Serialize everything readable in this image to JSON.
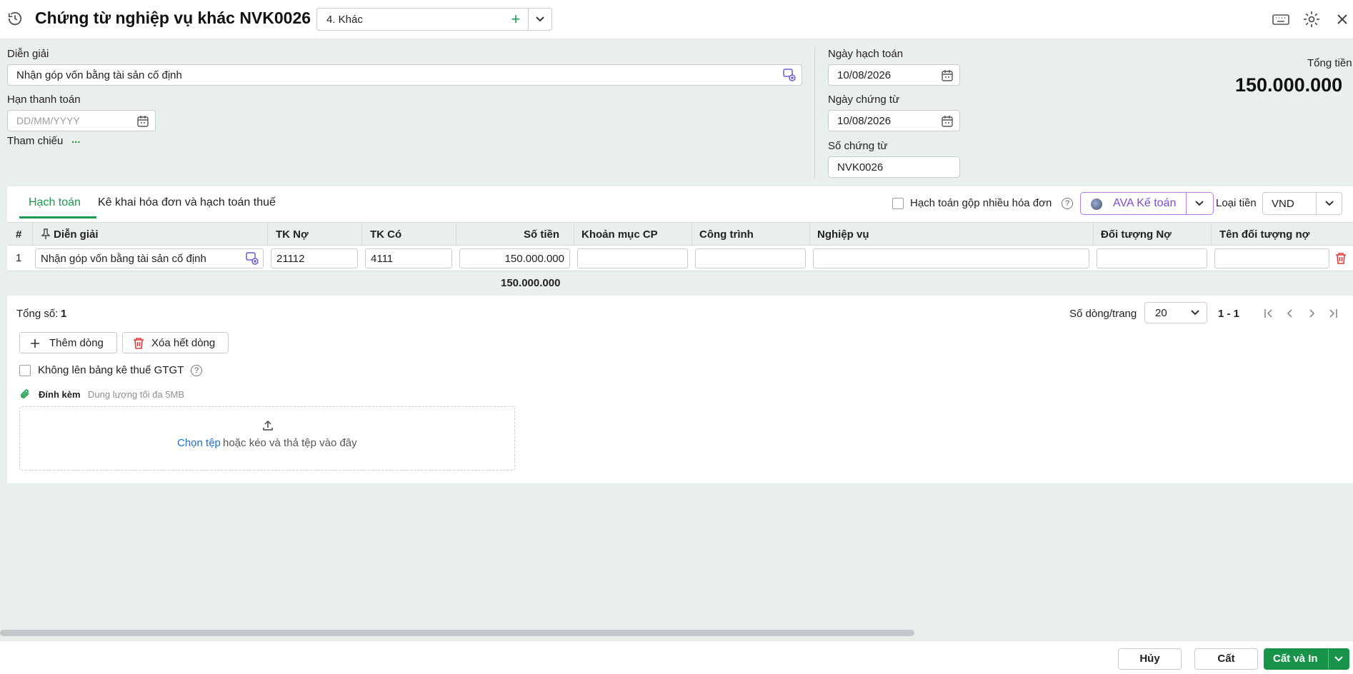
{
  "header": {
    "title": "Chứng từ nghiệp vụ khác NVK0026",
    "type_value": "4. Khác",
    "icons": [
      "history-icon",
      "keyboard-icon",
      "gear-icon",
      "close-icon"
    ]
  },
  "form": {
    "dien_giai_label": "Diễn giải",
    "dien_giai_value": "Nhận góp vốn bằng tài sản cố định",
    "han_tt_label": "Hạn thanh toán",
    "han_tt_placeholder": "DD/MM/YYYY",
    "tham_chieu_label": "Tham chiếu",
    "tham_chieu_more": "...",
    "ngay_hach_toan_label": "Ngày hạch toán",
    "ngay_hach_toan_value": "10/08/2026",
    "ngay_chung_tu_label": "Ngày chứng từ",
    "ngay_chung_tu_value": "10/08/2026",
    "so_chung_tu_label": "Số chứng từ",
    "so_chung_tu_value": "NVK0026",
    "tong_tien_label": "Tổng tiền",
    "tong_tien_value": "150.000.000"
  },
  "tabs": [
    {
      "label": "Hạch toán",
      "active": true
    },
    {
      "label": "Kê khai hóa đơn và hạch toán thuế",
      "active": false
    }
  ],
  "toolbar": {
    "gop_label": "Hạch toán gộp nhiều hóa đơn",
    "ava_label": "AVA Kế toán",
    "loai_tien_label": "Loại tiền",
    "loai_tien_value": "VND"
  },
  "table": {
    "headers": [
      "#",
      "Diễn giải",
      "TK Nợ",
      "TK Có",
      "Số tiền",
      "Khoản mục CP",
      "Công trình",
      "Nghiệp vụ",
      "Đối tượng Nợ",
      "Tên đối tượng nợ"
    ],
    "rows": [
      {
        "index": "1",
        "dien_giai": "Nhận góp vốn bằng tài sản cố định",
        "tk_no": "21112",
        "tk_co": "4111",
        "so_tien": "150.000.000"
      }
    ],
    "sum": "150.000.000"
  },
  "pager": {
    "total_label": "Tổng số:",
    "total_value": "1",
    "per_page_label": "Số dòng/trang",
    "per_page_value": "20",
    "range": "1 - 1"
  },
  "actions": {
    "add_row": "Thêm dòng",
    "delete_all": "Xóa hết dòng",
    "no_vat_label": "Không lên bảng kê thuế GTGT"
  },
  "attach": {
    "label": "Đính kèm",
    "hint": "Dung lượng tối đa 5MB",
    "choose": "Chọn tệp",
    "drop_text": "hoặc kéo và thả tệp vào đây"
  },
  "footer": {
    "cancel": "Hủy",
    "save": "Cất",
    "save_print": "Cất và In"
  },
  "colors": {
    "accent": "#1a9b4b",
    "ava": "#7b4bdc",
    "danger": "#e03b3b",
    "link": "#1d6fd1"
  }
}
